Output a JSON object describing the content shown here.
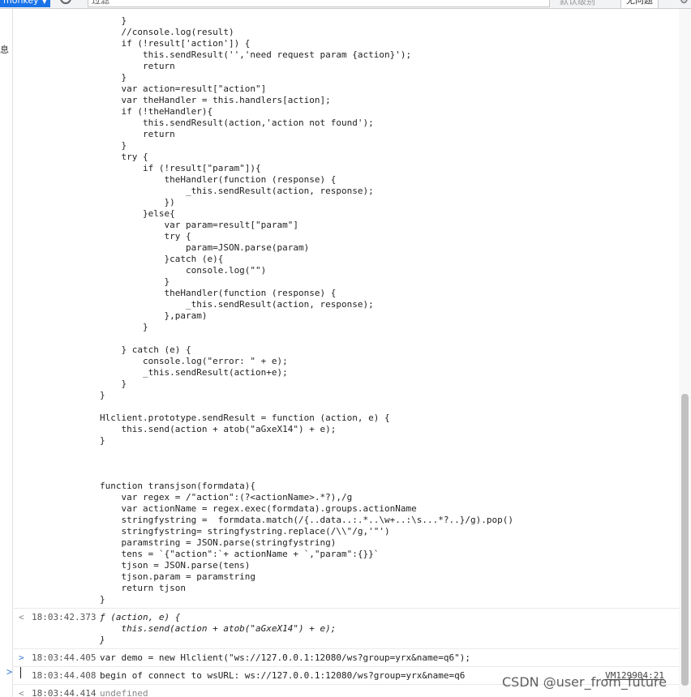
{
  "toolbar": {
    "context": "monkey",
    "filter_placeholder": "过滤",
    "levels": "默认级别",
    "issues": "无问题"
  },
  "sidebar": {
    "label": "息"
  },
  "code_lines": [
    "    }",
    "    //console.log(result)",
    "    if (!result['action']) {",
    "        this.sendResult('','need request param {action}');",
    "        return",
    "    }",
    "    var action=result[\"action\"]",
    "    var theHandler = this.handlers[action];",
    "    if (!theHandler){",
    "        this.sendResult(action,'action not found');",
    "        return",
    "    }",
    "    try {",
    "        if (!result[\"param\"]){",
    "            theHandler(function (response) {",
    "                _this.sendResult(action, response);",
    "            })",
    "        }else{",
    "            var param=result[\"param\"]",
    "            try {",
    "                param=JSON.parse(param)",
    "            }catch (e){",
    "                console.log(\"\")",
    "            }",
    "            theHandler(function (response) {",
    "                _this.sendResult(action, response);",
    "            },param)",
    "        }",
    "",
    "    } catch (e) {",
    "        console.log(\"error: \" + e);",
    "        _this.sendResult(action+e);",
    "    }",
    "}",
    "",
    "Hlclient.prototype.sendResult = function (action, e) {",
    "    this.send(action + atob(\"aGxeX14\") + e);",
    "}",
    "",
    "",
    "",
    "function transjson(formdata){",
    "    var regex = /\"action\":(?<actionName>.*?),/g",
    "    var actionName = regex.exec(formdata).groups.actionName",
    "    stringfystring =  formdata.match(/{..data..:.*..\\w+..:\\s...*?..}/g).pop()",
    "    stringfystring= stringfystring.replace(/\\\\\"/g,'\"')",
    "    paramstring = JSON.parse(stringfystring)",
    "    tens = `{\"action\":`+ actionName + `,\"param\":{}}`",
    "    tjson = JSON.parse(tens)",
    "    tjson.param = paramstring",
    "    return tjson",
    "}"
  ],
  "entries": [
    {
      "marker": "<",
      "timestamp": "18:03:42.373",
      "lines": [
        "ƒ (action, e) {",
        "    this.send(action + atob(\"aGxeX14\") + e);",
        "}"
      ]
    },
    {
      "marker": ">",
      "timestamp": "18:03:44.405",
      "lines": [
        "var demo = new Hlclient(\"ws://127.0.0.1:12080/ws?group=yrx&name=q6\");"
      ]
    },
    {
      "marker": "",
      "timestamp": "18:03:44.408",
      "lines": [
        "begin of connect to wsURL: ws://127.0.0.1:12080/ws?group=yrx&name=q6"
      ],
      "source": "VM129904:21"
    },
    {
      "marker": "<",
      "timestamp": "18:03:44.414",
      "lines": [
        "undefined"
      ]
    }
  ],
  "prompt": ">",
  "watermark": "CSDN @user_from_future"
}
